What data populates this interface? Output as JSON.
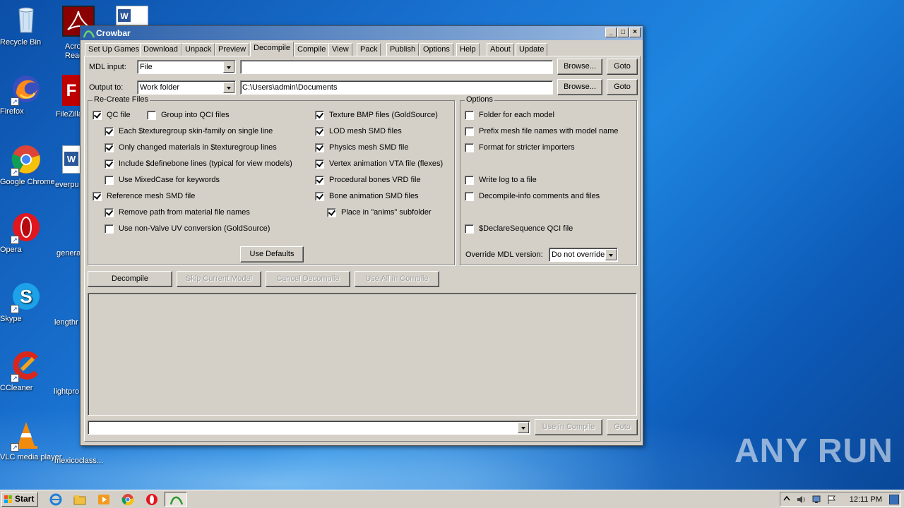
{
  "desktop": {
    "icons": [
      {
        "label": "Recycle Bin"
      },
      {
        "label": "Firefox"
      },
      {
        "label": "Google Chrome"
      },
      {
        "label": "Opera"
      },
      {
        "label": "Skype"
      },
      {
        "label": "CCleaner"
      },
      {
        "label": "VLC media player"
      }
    ],
    "second_column": [
      {
        "label": "Acro Reade"
      },
      {
        "label": "FileZilla"
      },
      {
        "label": "everpu"
      },
      {
        "label": "genera"
      },
      {
        "label": "lengthr"
      },
      {
        "label": "lightpro"
      },
      {
        "label": "mexicoclass..."
      }
    ],
    "watermark": "ANY RUN"
  },
  "window": {
    "title": "Crowbar",
    "controls": {
      "minimize": "_",
      "maximize": "□",
      "close": "×"
    }
  },
  "tabs": [
    {
      "label": "Set Up Games"
    },
    {
      "label": "Download"
    },
    {
      "label": "Unpack"
    },
    {
      "label": "Preview"
    },
    {
      "label": "Decompile",
      "active": true
    },
    {
      "label": "Compile"
    },
    {
      "label": "View"
    },
    {
      "label": "Pack"
    },
    {
      "label": "Publish"
    },
    {
      "label": "Options"
    },
    {
      "label": "Help"
    },
    {
      "label": "About"
    },
    {
      "label": "Update"
    }
  ],
  "decompile": {
    "mdl_input_label": "MDL input:",
    "mdl_input_mode": "File",
    "mdl_input_path": "",
    "output_label": "Output to:",
    "output_mode": "Work folder",
    "output_path": "C:\\Users\\admin\\Documents",
    "browse_label": "Browse...",
    "goto_label": "Goto",
    "recreate_group": {
      "title": "Re-Create Files",
      "qc_file": {
        "label": "QC file",
        "checked": true
      },
      "group_qci": {
        "label": "Group into QCI files",
        "checked": false
      },
      "texturegroup_single_line": {
        "label": "Each $texturegroup skin-family on single line",
        "checked": true
      },
      "changed_materials": {
        "label": "Only changed materials in $texturegroup lines",
        "checked": true
      },
      "definebone": {
        "label": "Include $definebone lines (typical for view models)",
        "checked": true
      },
      "mixedcase": {
        "label": "Use MixedCase for keywords",
        "checked": false
      },
      "reference_mesh": {
        "label": "Reference mesh SMD file",
        "checked": true
      },
      "remove_path": {
        "label": "Remove path from material file names",
        "checked": true
      },
      "non_valve_uv": {
        "label": "Use non-Valve UV conversion (GoldSource)",
        "checked": false
      },
      "texture_bmp": {
        "label": "Texture BMP files (GoldSource)",
        "checked": true
      },
      "lod_mesh": {
        "label": "LOD mesh SMD files",
        "checked": true
      },
      "physics_mesh": {
        "label": "Physics mesh SMD file",
        "checked": true
      },
      "vertex_anim": {
        "label": "Vertex animation VTA file (flexes)",
        "checked": true
      },
      "procedural_bones": {
        "label": "Procedural bones VRD file",
        "checked": true
      },
      "bone_anim": {
        "label": "Bone animation SMD files",
        "checked": true
      },
      "anims_subfolder": {
        "label": "Place in \"anims\" subfolder",
        "checked": true
      },
      "use_defaults": "Use Defaults"
    },
    "options_group": {
      "title": "Options",
      "folder_each_model": {
        "label": "Folder for each model",
        "checked": false
      },
      "prefix_mesh": {
        "label": "Prefix mesh file names with model name",
        "checked": false
      },
      "stricter_importers": {
        "label": "Format for stricter importers",
        "checked": false
      },
      "write_log": {
        "label": "Write log to a file",
        "checked": false
      },
      "decompile_info": {
        "label": "Decompile-info comments and files",
        "checked": false
      },
      "declare_sequence": {
        "label": "$DeclareSequence QCI file",
        "checked": false
      },
      "override_label": "Override MDL version:",
      "override_value": "Do not override"
    },
    "actions": {
      "decompile": "Decompile",
      "skip_current": "Skip Current Model",
      "cancel": "Cancel Decompile",
      "use_all_compile": "Use All in Compile"
    },
    "bottom": {
      "use_in_compile": "Use in Compile",
      "goto": "Goto"
    }
  },
  "taskbar": {
    "start_label": "Start",
    "clock": "12:11 PM"
  }
}
